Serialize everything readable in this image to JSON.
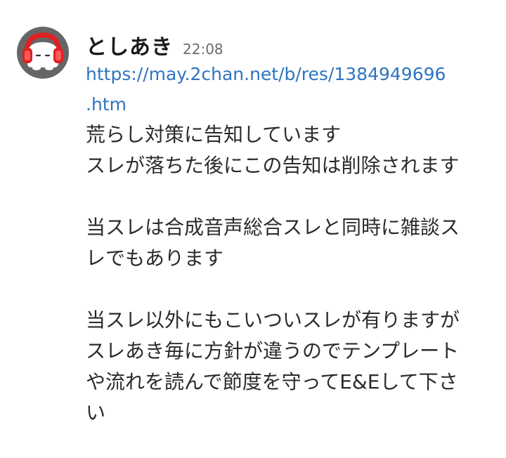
{
  "message": {
    "author": "としあき",
    "time": "22:08",
    "link": {
      "line1": "https://may.2chan.net/b/res/1384949696",
      "line2": ".htm"
    },
    "paragraphs": [
      [
        "荒らし対策に告知しています",
        "スレが落ちた後にこの告知は削除されます"
      ],
      [
        "当スレは合成音声総合スレと同時に雑談ス",
        "レでもあります"
      ],
      [
        "当スレ以外にもこいついスレが有りますが",
        "スレあき毎に方針が違うのでテンプレート",
        "や流れを読んで節度を守ってE&Eして下さ",
        "い"
      ]
    ]
  },
  "avatar": {
    "icon": "headphone-character-icon",
    "colors": {
      "background": "#666666",
      "headphones": "#e02020",
      "face": "#ffffff"
    }
  },
  "colors": {
    "link": "#2f74c0",
    "text": "#2b2b2b",
    "timestamp": "#6b6b6b"
  }
}
